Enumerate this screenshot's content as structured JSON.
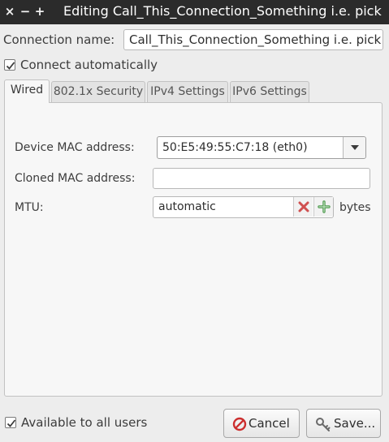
{
  "window": {
    "title": "Editing Call_This_Connection_Something i.e. pick",
    "close_glyph": "×",
    "minimize_glyph": "−",
    "maximize_glyph": "+"
  },
  "connection_name": {
    "label": "Connection name:",
    "value": "Call_This_Connection_Something i.e. pick"
  },
  "connect_automatically": {
    "label": "Connect automatically",
    "checked": true
  },
  "tabs": [
    {
      "label": "Wired",
      "active": true
    },
    {
      "label": "802.1x Security",
      "active": false
    },
    {
      "label": "IPv4 Settings",
      "active": false
    },
    {
      "label": "IPv6 Settings",
      "active": false
    }
  ],
  "wired": {
    "device_mac": {
      "label": "Device MAC address:",
      "value": "50:E5:49:55:C7:18 (eth0)"
    },
    "cloned_mac": {
      "label": "Cloned MAC address:",
      "value": ""
    },
    "mtu": {
      "label": "MTU:",
      "value": "automatic",
      "unit": "bytes"
    }
  },
  "available_to_all_users": {
    "label": "Available to all users",
    "checked": true
  },
  "buttons": {
    "cancel": "Cancel",
    "save": "Save..."
  },
  "icons": {
    "close": "close-icon",
    "minimize": "minimize-icon",
    "maximize": "maximize-icon",
    "dropdown": "chevron-down-icon",
    "clear": "clear-icon",
    "increment": "plus-icon",
    "cancel": "cancel-icon",
    "save": "keys-icon"
  },
  "colors": {
    "titlebar": "#2b2b2b",
    "clear_icon": "#d05050",
    "plus_icon": "#4e9a4e",
    "cancel_icon": "#cc2e2e"
  }
}
